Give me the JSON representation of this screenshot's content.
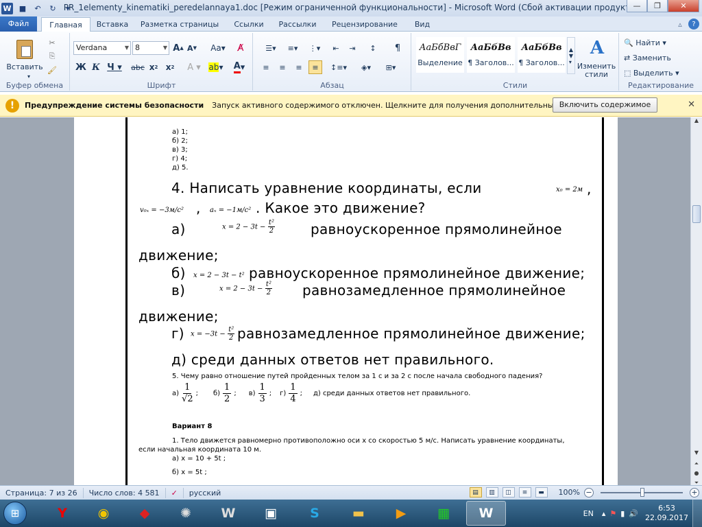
{
  "window": {
    "title": "PR_1elementy_kinematiki_peredelannaya1.doc [Режим ограниченной функциональности]  -  Microsoft Word (Сбой активации продукта)"
  },
  "tabs": [
    "Файл",
    "Главная",
    "Вставка",
    "Разметка страницы",
    "Ссылки",
    "Рассылки",
    "Рецензирование",
    "Вид"
  ],
  "ribbon": {
    "clipboard": {
      "paste": "Вставить",
      "label": "Буфер обмена"
    },
    "font": {
      "name": "Verdana",
      "size": "8",
      "label": "Шрифт"
    },
    "paragraph": {
      "label": "Абзац"
    },
    "styles": {
      "items": [
        {
          "sample": "АаБбВвГ",
          "name": "Выделение"
        },
        {
          "sample": "АаБбВв",
          "name": "¶ Заголов..."
        },
        {
          "sample": "АаБбВв",
          "name": "¶ Заголов..."
        }
      ],
      "change": "Изменить стили",
      "label": "Стили"
    },
    "editing": {
      "find": "Найти",
      "replace": "Заменить",
      "select": "Выделить",
      "label": "Редактирование"
    }
  },
  "security": {
    "title": "Предупреждение системы безопасности",
    "message": "Запуск активного содержимого отключен. Щелкните для получения дополнительных сведений.",
    "button": "Включить содержимое"
  },
  "doc": {
    "list": [
      "а) 1;",
      "б) 2;",
      "в) 3;",
      "г) 4;",
      "д) 5."
    ],
    "q4_prefix": "4.  Написать  уравнение  координаты,  если",
    "q4_x0": "x₀ = 2м",
    "q4_v0": "v₀ₓ = −3м/с²",
    "q4_a": "aₓ = −1м/с²",
    "q4_question": ". Какое это движение?",
    "q4_a_label": "а)",
    "q4_a_formula": "x = 2 − 3t −",
    "q4_a_text": "равноускоренное     прямолинейное",
    "wrap": "движение;",
    "q4_b_label": "б)",
    "q4_b_formula": "x = 2 − 3t − t²",
    "q4_b_text": "равноускоренное прямолинейное движение;",
    "q4_c_label": "в)",
    "q4_c_formula": "x = 2 − 3t −",
    "q4_c_text": "равнозамедленное      прямолинейное",
    "q4_d_label": "г)",
    "q4_d_formula": "x = −3t −",
    "q4_d_text": "равнозамедленное прямолинейное движение;",
    "q4_e": "д) среди данных ответов нет правильного.",
    "frac_num": "t²",
    "frac_den": "2",
    "q5": "5. Чему равно отношение путей пройденных телом за 1 с и за 2 с после начала свободного падения?",
    "q5_answers": {
      "a_label": "а)",
      "a_num": "1",
      "a_den": "√2",
      "b_label": "б)",
      "b_num": "1",
      "b_den": "2",
      "c_label": "в)",
      "c_num": "1",
      "c_den": "3",
      "d_label": "г)",
      "d_num": "1",
      "d_den": "4",
      "sep": ";",
      "e": "д) среди данных ответов нет правильного."
    },
    "variant": "Вариант 8",
    "v8_q1_line1": "1. Тело движется равномерно противоположно оси x со скоростью 5 м/с. Написать уравнение координаты,",
    "v8_q1_line2": "если начальная координата 10 м.",
    "v8_a": "а) x = 10 + 5t ;",
    "v8_b": "б)   x = 5t ;"
  },
  "status": {
    "page": "Страница: 7 из 26",
    "words": "Число слов: 4 581",
    "lang": "русский",
    "zoom": "100%"
  },
  "taskbar": {
    "lang": "EN",
    "time": "6:53",
    "date": "22.09.2017"
  }
}
